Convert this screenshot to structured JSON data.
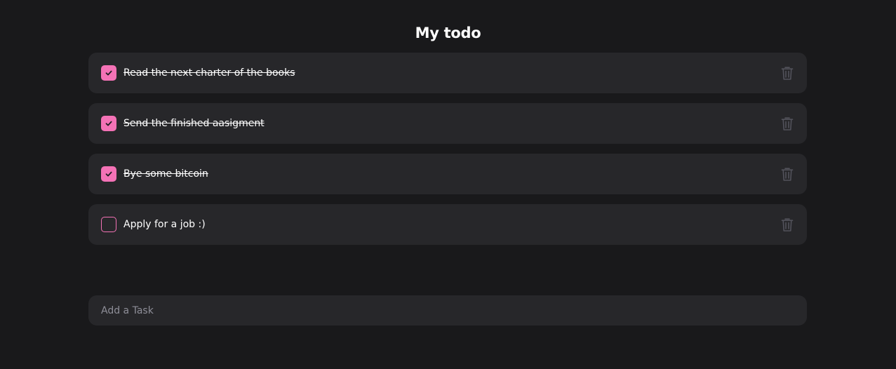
{
  "header": {
    "title": "My todo"
  },
  "todos": [
    {
      "label": "Read the next charter of the books",
      "done": true
    },
    {
      "label": "Send the finished aasigment",
      "done": true
    },
    {
      "label": "Bye some bitcoin",
      "done": true
    },
    {
      "label": "Apply for a job :)",
      "done": false
    }
  ],
  "add_task": {
    "placeholder": "Add a Task",
    "value": ""
  },
  "icons": {
    "checkbox": "check-icon",
    "delete": "trash-icon"
  },
  "colors": {
    "background": "#19191b",
    "card": "#27272a",
    "accent": "#f472b6",
    "trash": "#52525b",
    "placeholder": "#8e8e98"
  }
}
